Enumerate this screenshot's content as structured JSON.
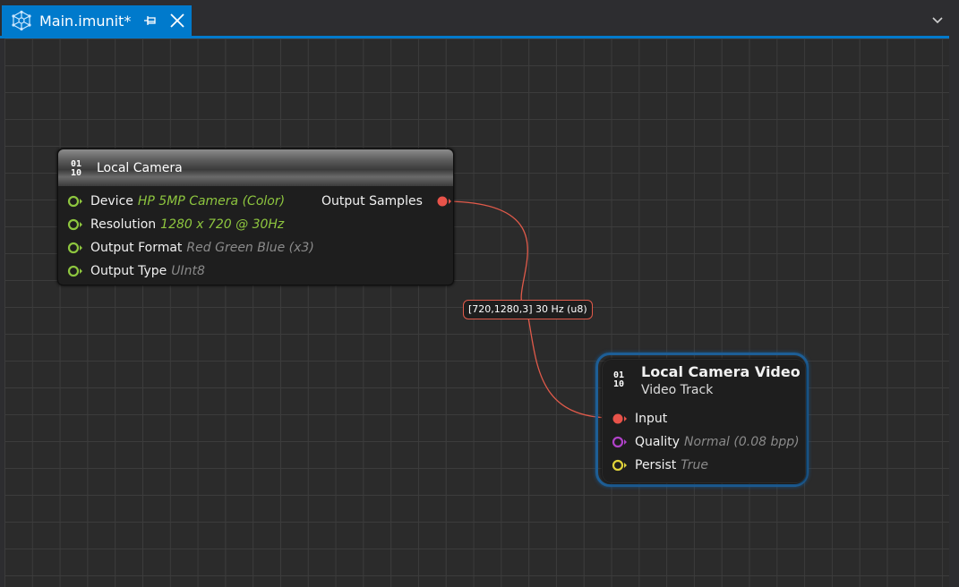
{
  "tab": {
    "title": "Main.imunit*",
    "icons": {
      "logo": "network-graph-icon",
      "pin": "pin-icon",
      "close": "close-icon"
    }
  },
  "overflow_icon": "chevron-down-icon",
  "colors": {
    "accent": "#007acc",
    "value_green": "#8ec63f",
    "value_gray": "#8a8a8a",
    "pin_green": "#8ec63f",
    "pin_red": "#e8534a",
    "pin_purple": "#b042c8",
    "pin_yellow": "#e0d23a",
    "edge": "#e05a4a",
    "selection": "#1d5e96"
  },
  "nodes": {
    "local_camera": {
      "icon_top": "01",
      "icon_bottom": "10",
      "title": "Local Camera",
      "inputs": [
        {
          "label": "Device",
          "value": "HP 5MP Camera (Color)",
          "style": "green"
        },
        {
          "label": "Resolution",
          "value": "1280 x 720 @ 30Hz",
          "style": "green"
        },
        {
          "label": "Output Format",
          "value": "Red Green Blue (x3)",
          "style": "gray"
        },
        {
          "label": "Output Type",
          "value": "UInt8",
          "style": "gray"
        }
      ],
      "output": {
        "label": "Output Samples"
      }
    },
    "local_camera_video": {
      "icon_top": "01",
      "icon_bottom": "10",
      "title": "Local Camera Video",
      "subtitle": "Video Track",
      "inputs": [
        {
          "label": "Input",
          "value": "",
          "pin": "red"
        },
        {
          "label": "Quality",
          "value": "Normal (0.08 bpp)",
          "pin": "purple"
        },
        {
          "label": "Persist",
          "value": "True",
          "pin": "yellow"
        }
      ]
    }
  },
  "connection": {
    "label": "[720,1280,3] 30 Hz (u8)"
  }
}
